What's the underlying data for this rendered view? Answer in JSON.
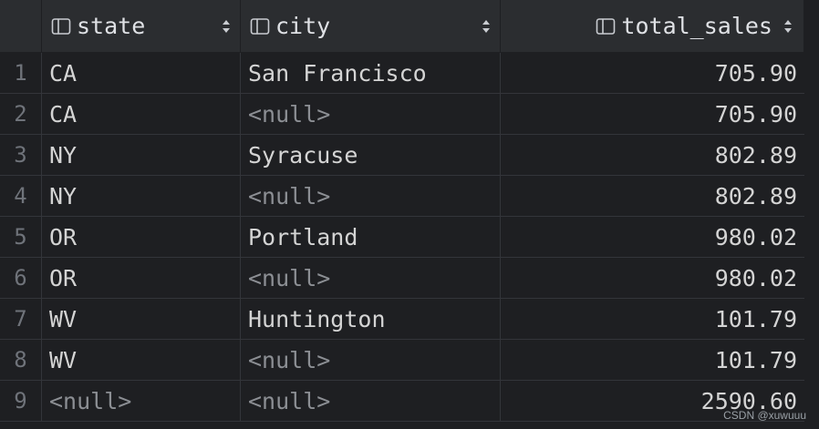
{
  "columns": {
    "state": "state",
    "city": "city",
    "total_sales": "total_sales"
  },
  "rows": [
    {
      "num": "1",
      "state": "CA",
      "city": "San Francisco",
      "total_sales": "705.90"
    },
    {
      "num": "2",
      "state": "CA",
      "city": "<null>",
      "total_sales": "705.90"
    },
    {
      "num": "3",
      "state": "NY",
      "city": "Syracuse",
      "total_sales": "802.89"
    },
    {
      "num": "4",
      "state": "NY",
      "city": "<null>",
      "total_sales": "802.89"
    },
    {
      "num": "5",
      "state": "OR",
      "city": "Portland",
      "total_sales": "980.02"
    },
    {
      "num": "6",
      "state": "OR",
      "city": "<null>",
      "total_sales": "980.02"
    },
    {
      "num": "7",
      "state": "WV",
      "city": "Huntington",
      "total_sales": "101.79"
    },
    {
      "num": "8",
      "state": "WV",
      "city": "<null>",
      "total_sales": "101.79"
    },
    {
      "num": "9",
      "state": "<null>",
      "city": "<null>",
      "total_sales": "2590.60"
    }
  ],
  "watermark": "CSDN @xuwuuu",
  "icons": {
    "column": "column-icon",
    "sort": "sort-toggle-icon"
  },
  "colors": {
    "background": "#1e1f22",
    "header_background": "#2b2d30",
    "text": "#d4d4d4",
    "null_text": "#8c8f94",
    "row_number": "#6f737a"
  }
}
